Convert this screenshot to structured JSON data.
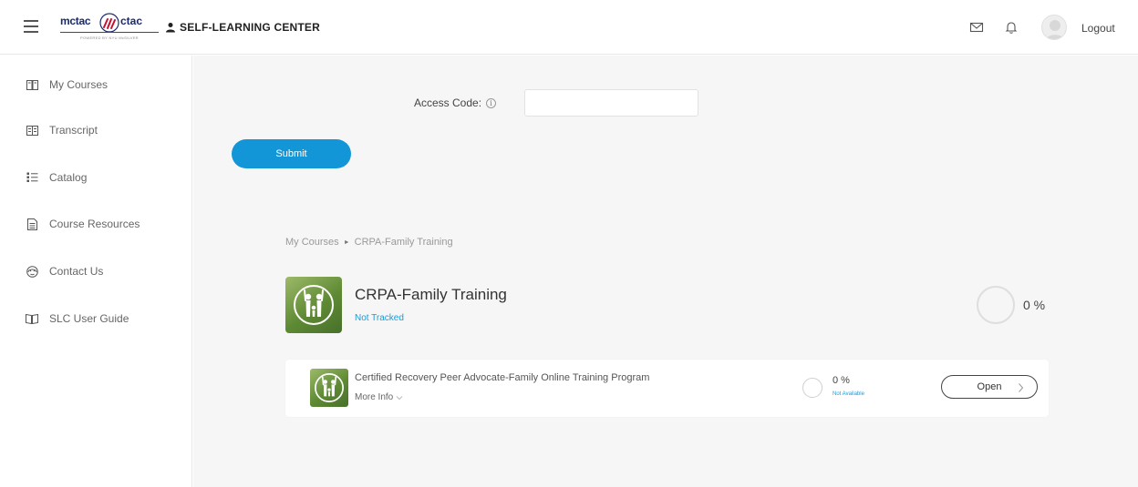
{
  "header": {
    "logo_left": "mctac",
    "logo_right": "ctac",
    "logo_powered": "POWERED BY NYU McSILVER",
    "app_title": "SELF-LEARNING CENTER",
    "logout_label": "Logout"
  },
  "sidebar": {
    "items": [
      {
        "label": "My Courses",
        "icon": "book-open-icon"
      },
      {
        "label": "Transcript",
        "icon": "transcript-icon"
      },
      {
        "label": "Catalog",
        "icon": "list-icon"
      },
      {
        "label": "Course Resources",
        "icon": "document-icon"
      },
      {
        "label": "Contact Us",
        "icon": "contact-icon"
      },
      {
        "label": "SLC User Guide",
        "icon": "guide-book-icon"
      }
    ]
  },
  "access": {
    "label": "Access Code:",
    "info_glyph": "i",
    "input_value": "",
    "submit_label": "Submit"
  },
  "breadcrumb": {
    "root": "My Courses",
    "separator": "►",
    "current": "CRPA-Family Training"
  },
  "course": {
    "title": "CRPA-Family Training",
    "status": "Not Tracked",
    "progress": "0 %",
    "progress_fraction": 0
  },
  "module": {
    "title": "Certified Recovery Peer Advocate-Family Online Training Program",
    "more_info": "More Info",
    "progress": "0 %",
    "progress_fraction": 0,
    "availability": "Not Available",
    "open_label": "Open"
  },
  "colors": {
    "accent": "#1296d8",
    "link": "#1b9ad6",
    "thumb_green": "#5f8a34",
    "brand_navy": "#1a2b6d",
    "brand_red": "#c8102e"
  }
}
